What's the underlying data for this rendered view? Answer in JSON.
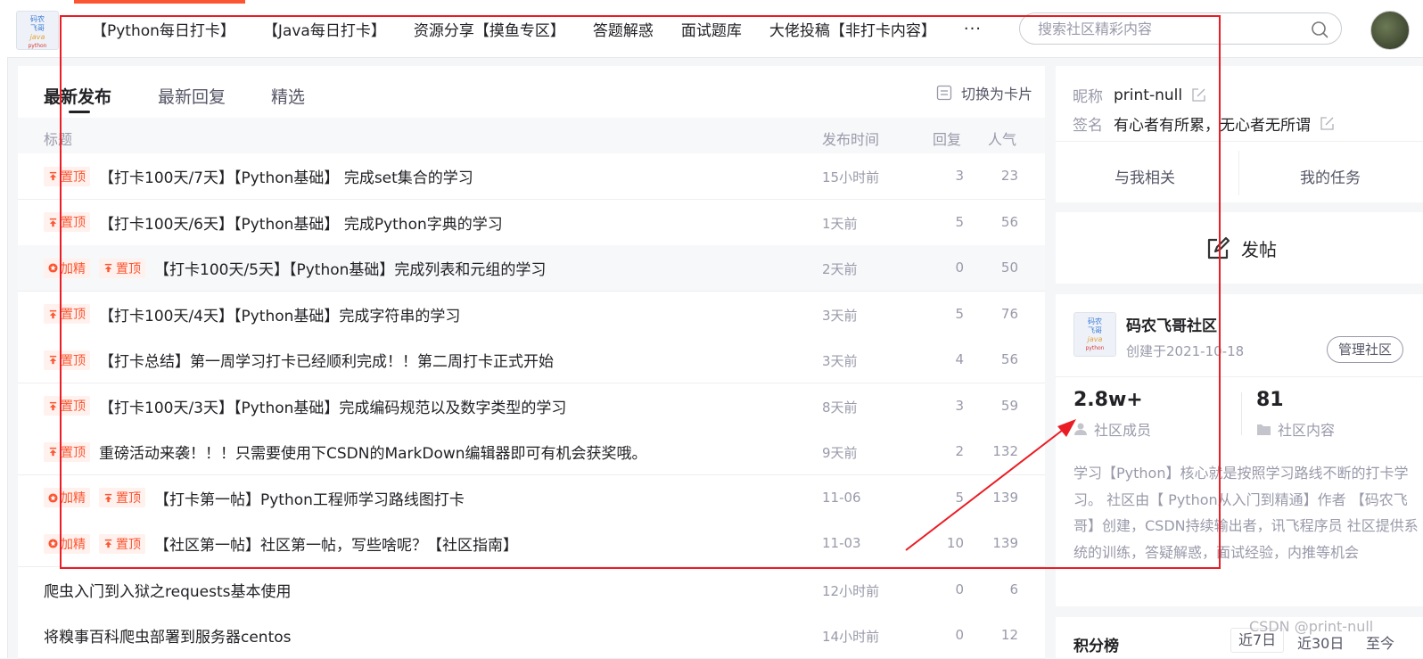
{
  "nav": {
    "logo_text": [
      "码农",
      "飞哥",
      "java",
      "python"
    ],
    "items": [
      "【Python每日打卡】",
      "【Java每日打卡】",
      "资源分享【摸鱼专区】",
      "答题解惑",
      "面试题库",
      "大佬投稿【非打卡内容】",
      "···"
    ],
    "search_placeholder": "搜索社区精彩内容",
    "search_icon": "search-icon",
    "accent_color": "#fc5531"
  },
  "main": {
    "tabs": [
      "最新发布",
      "最新回复",
      "精选"
    ],
    "active_tab": "最新发布",
    "switch_label": "切换为卡片",
    "columns": {
      "title": "标题",
      "time": "发布时间",
      "replies": "回复",
      "popularity": "人气"
    },
    "rows": [
      {
        "badges": [
          "置顶"
        ],
        "title": "【打卡100天/7天】【Python基础】 完成set集合的学习",
        "time": "15小时前",
        "replies": "3",
        "popularity": "23"
      },
      {
        "badges": [
          "置顶"
        ],
        "title": "【打卡100天/6天】【Python基础】 完成Python字典的学习",
        "time": "1天前",
        "replies": "5",
        "popularity": "56"
      },
      {
        "badges": [
          "加精",
          "置顶"
        ],
        "title": "【打卡100天/5天】【Python基础】完成列表和元组的学习",
        "time": "2天前",
        "replies": "0",
        "popularity": "50"
      },
      {
        "badges": [
          "置顶"
        ],
        "title": "【打卡100天/4天】【Python基础】完成字符串的学习",
        "time": "3天前",
        "replies": "5",
        "popularity": "76"
      },
      {
        "badges": [
          "置顶"
        ],
        "title": "【打卡总结】第一周学习打卡已经顺利完成！！第二周打卡正式开始",
        "time": "3天前",
        "replies": "4",
        "popularity": "56"
      },
      {
        "badges": [
          "置顶"
        ],
        "title": "【打卡100天/3天】【Python基础】完成编码规范以及数字类型的学习",
        "time": "8天前",
        "replies": "3",
        "popularity": "59"
      },
      {
        "badges": [
          "置顶"
        ],
        "title": "重磅活动来袭！！！只需要使用下CSDN的MarkDown编辑器即可有机会获奖哦。",
        "time": "9天前",
        "replies": "2",
        "popularity": "132"
      },
      {
        "badges": [
          "加精",
          "置顶"
        ],
        "title": "【打卡第一帖】Python工程师学习路线图打卡",
        "time": "11-06",
        "replies": "5",
        "popularity": "139"
      },
      {
        "badges": [
          "加精",
          "置顶"
        ],
        "title": "【社区第一帖】社区第一帖，写些啥呢？【社区指南】",
        "time": "11-03",
        "replies": "10",
        "popularity": "139"
      },
      {
        "badges": [],
        "title": "爬虫入门到入狱之requests基本使用",
        "time": "12小时前",
        "replies": "0",
        "popularity": "6"
      },
      {
        "badges": [],
        "title": "将糗事百科爬虫部署到服务器centos",
        "time": "14小时前",
        "replies": "0",
        "popularity": "12"
      }
    ]
  },
  "profile": {
    "nickname_label": "昵称",
    "nickname": "print-null",
    "signature_label": "签名",
    "signature": "有心者有所累，无心者无所谓",
    "tabs": [
      "与我相关",
      "我的任务"
    ]
  },
  "post": {
    "label": "发帖"
  },
  "community": {
    "logo_text": [
      "码农",
      "飞哥",
      "java",
      "python"
    ],
    "name": "码农飞哥社区",
    "created": "创建于2021-10-18",
    "manage_label": "管理社区",
    "members_value": "2.8w+",
    "members_label": "社区成员",
    "content_value": "81",
    "content_label": "社区内容",
    "description": "学习【Python】核心就是按照学习路线不断的打卡学习。 社区由【 Python从入门到精通】作者 【码农飞哥】创建，CSDN持续输出者，讯飞程序员 社区提供系统的训练，答疑解惑，面试经验，内推等机会"
  },
  "ranking": {
    "title": "积分榜",
    "tabs": [
      "近7日",
      "近30日",
      "至今"
    ]
  },
  "watermark": "CSDN @print-null"
}
